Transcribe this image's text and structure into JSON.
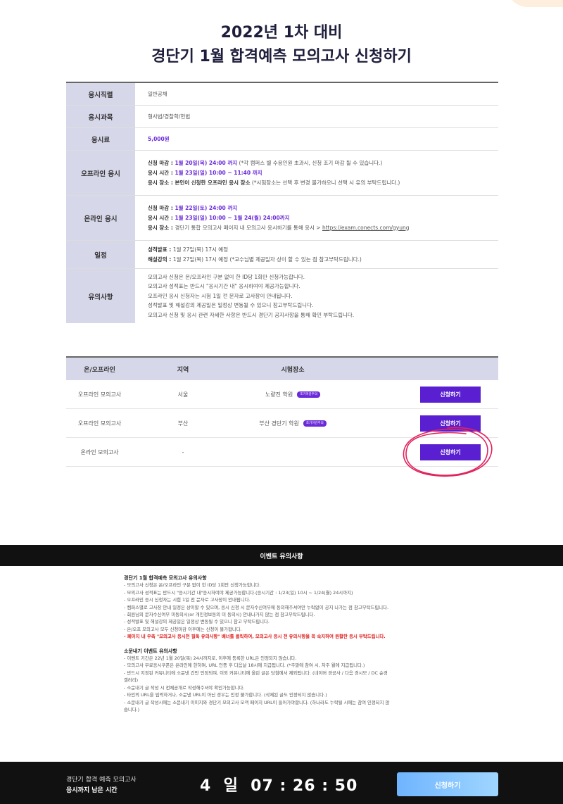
{
  "title": {
    "line1": "2022년 1차 대비",
    "line2": "경단기 1월 합격예측 모의고사 신청하기"
  },
  "info": {
    "job": {
      "label": "응시직렬",
      "value": "일반공채"
    },
    "subject": {
      "label": "응시과목",
      "value": "형사법/경찰학/헌법"
    },
    "fee": {
      "label": "응시료",
      "value": "5,000원"
    },
    "offline": {
      "label": "오프라인 응시",
      "deadline_label": "신청 마감 : ",
      "deadline_value": "1월 20일(목) 24:00 까지",
      "deadline_note": " (*각 캠퍼스 별 수용인원 초과시, 신청 조기 마감 될 수 있습니다.)",
      "time_label": "응시 시간 : ",
      "time_value": "1월 23일(일) 10:00 ~ 11:40 까지",
      "place_label": "응시 장소 : ",
      "place_value": "본인이 신청한 오프라인 응시 장소",
      "place_note": " (*시험장소는 선택 후 변경 불가하오니 선택 시 유의 부탁드립니다.)"
    },
    "online": {
      "label": "온라인 응시",
      "deadline_label": "신청 마감 : ",
      "deadline_value": "1월 22일(토) 24:00 까지",
      "time_label": "응시 시간 : ",
      "time_value": "1월 23일(일) 10:00 ~ 1월 24(월) 24:00까지",
      "place_label": "응시 장소 : ",
      "place_value": "경단기 통합 모의고사 페이지 내 모의고사 응시하기를 통해 응시 > ",
      "place_link": "https://exam.conects.com/gyung"
    },
    "schedule": {
      "label": "일정",
      "result_label": "성적발표 : ",
      "result_value": "1월 27일(목) 17시 예정",
      "lecture_label": "해설강의 : ",
      "lecture_value": "1월 27일(목) 17시 예정 (*교수님별 제공일자 상이 할 수 있는 점 참고부탁드립니다.)"
    },
    "caution": {
      "label": "유의사항",
      "lines": [
        "모의고사 신청은 온/오프라인 구분 없이 한 ID당 1회만 신청가능합니다.",
        "모의고사 성적표는 반드시 \"응시기간 내\" 응시하여야 제공가능합니다.",
        "오프라인 응시 신청자는 시험 1일 전 문자로 고사장이 안내됩니다.",
        "성적발표 및 해설강의 제공일은 일정상 변동될 수 있으니 참고부탁드립니다.",
        "모의고사 신청 및 응시 관련 자세한 사항은 반드시 경단기 공지사항을 통해 확인 부탁드립니다."
      ]
    }
  },
  "venue": {
    "headers": {
      "type": "온/오프라인",
      "region": "지역",
      "place": "시험장소"
    },
    "rows": [
      {
        "type": "오프라인 모의고사",
        "region": "서울",
        "place": "노량진 학원",
        "tag": "조기마감주의",
        "button": "신청하기"
      },
      {
        "type": "오프라인 모의고사",
        "region": "부산",
        "place": "부산 경단기 학원",
        "tag": "조기마감주의",
        "button": "신청하기"
      },
      {
        "type": "온라인 모의고사",
        "region": "-",
        "place": "",
        "button": "신청하기"
      }
    ]
  },
  "notice": {
    "bar_title": "이벤트 유의사항",
    "section1_title": "경단기 1월 합격예측 모의고사 유의사항",
    "section1_lines": [
      "- 모의고사 신청은 온/오프라인 구분 없이 한 ID당 1회만 신청가능합니다.",
      "- 모의고사 성적표는 반드시 \"응시기간 내\"응시하여야 제공가능합니다.(응시기간 : 1/23(일) 10시 ~ 1/24(월) 24시까지)",
      "- 오프라인 응시 신청자는 시험 1일 전 문자로 고사장이 안내됩니다.",
      "- 캠퍼스별로 고사장 안내 일정은 상이할 수 있으며, 응시 신청 시 문자수신여부에 동의해주셔야만 누락없이 공지 나가는 점 참고부탁드립니다.",
      "- 회원님의 문자수신여부 미동의시(or 개인정보동의 미 동의시) 안내나가지 않는 점 참고부탁드립니다.",
      "- 성적발표 및 해설강의 제공일은 일정상 변동될 수 있으니 참고 부탁드립니다.",
      "- 온/오프 모의고사 모두 신청마감 이후에는 신청이 불가합니다."
    ],
    "section1_red": "- 페이지 내 우측 \"모의고사 응시전 필독 유의사항\" 배너를 클릭하여, 모의고사 응시 전 유의사항을 꼭 숙지하여 원활한 응시 부탁드립니다.",
    "section2_title": "소문내기 이벤트 유의사항",
    "section2_lines": [
      "- 이벤트 기간은 22년 1월 20일(목) 24시까지로, 이후에 등록한 URL은 인정되지 않습니다.",
      "- 모의고사 무료응시쿠폰은 온라인에 한하며, URL 인증 후 다음날 18시에 지급됩니다. (*주말에 참여 시, 차주 월에 지급됩니다.)",
      "- 반드시 지정된 커뮤니티에 소문낸 건만 인정되며, 이외 커뮤니티에 올린 글은 당첨에서 제외됩니다. (네이버 경공사 / 다음 경시모 / DC 순경",
      "갤러리)",
      "- 소문내기 글 작성 시 전체공개로 작성해주셔야 확인가능합니다.",
      "- 타인의 URL을 입력하거나, 소문낸 URL이 아닌 경우는 인정 불가합니다. (삭제된 글도 인정되지 않습니다.)",
      "- 소문내기 글 작성시에는 소문내기 이미지와 경단기 모의고사 모객 페이지 URL이 들어가야합니다. (하나라도 누락될 시에는 참여 인정되지 않",
      "습니다.)"
    ]
  },
  "footer": {
    "label1": "경단기 합격 예측 모의고사",
    "label2": "응시까지 남은 시간",
    "timer": "4  일  07 : 26 : 50",
    "button": "신청하기"
  },
  "colors": {
    "accent": "#5a1fd1",
    "header_bg": "#d7d7ea",
    "scribble": "#e0245e"
  }
}
